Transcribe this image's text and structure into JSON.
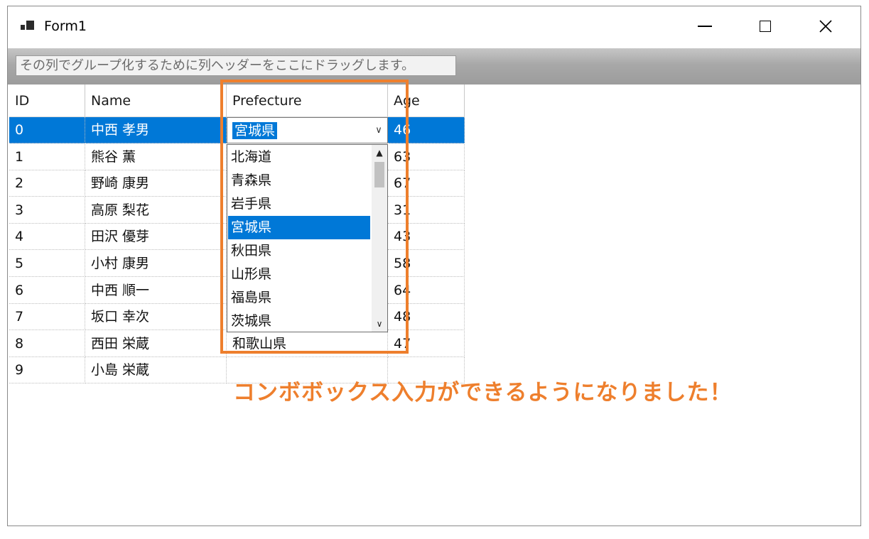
{
  "window": {
    "title": "Form1"
  },
  "group_panel": {
    "hint": "その列でグループ化するために列ヘッダーをここにドラッグします。"
  },
  "grid": {
    "columns": [
      "ID",
      "Name",
      "Prefecture",
      "Age"
    ],
    "rows": [
      {
        "id": "0",
        "name": "中西 孝男",
        "age": "46"
      },
      {
        "id": "1",
        "name": "熊谷 薫",
        "age": "63"
      },
      {
        "id": "2",
        "name": "野崎 康男",
        "age": "67"
      },
      {
        "id": "3",
        "name": "高原 梨花",
        "age": "31"
      },
      {
        "id": "4",
        "name": "田沢 優芽",
        "age": "43"
      },
      {
        "id": "5",
        "name": "小村 康男",
        "age": "58"
      },
      {
        "id": "6",
        "name": "中西 順一",
        "age": "64"
      },
      {
        "id": "7",
        "name": "坂口 幸次",
        "age": "48"
      },
      {
        "id": "8",
        "name": "西田 栄蔵",
        "prefecture": "和歌山県",
        "age": "47"
      },
      {
        "id": "9",
        "name": "小島 栄蔵"
      }
    ],
    "selected_row": 0
  },
  "combo": {
    "value": "宮城県",
    "options": [
      "北海道",
      "青森県",
      "岩手県",
      "宮城県",
      "秋田県",
      "山形県",
      "福島県",
      "茨城県"
    ],
    "selected_index": 3
  },
  "annotation": {
    "text": "コンボボックス入力ができるようになりました！"
  },
  "colors": {
    "accent": "#ee7f2d",
    "selection": "#0078d7"
  }
}
